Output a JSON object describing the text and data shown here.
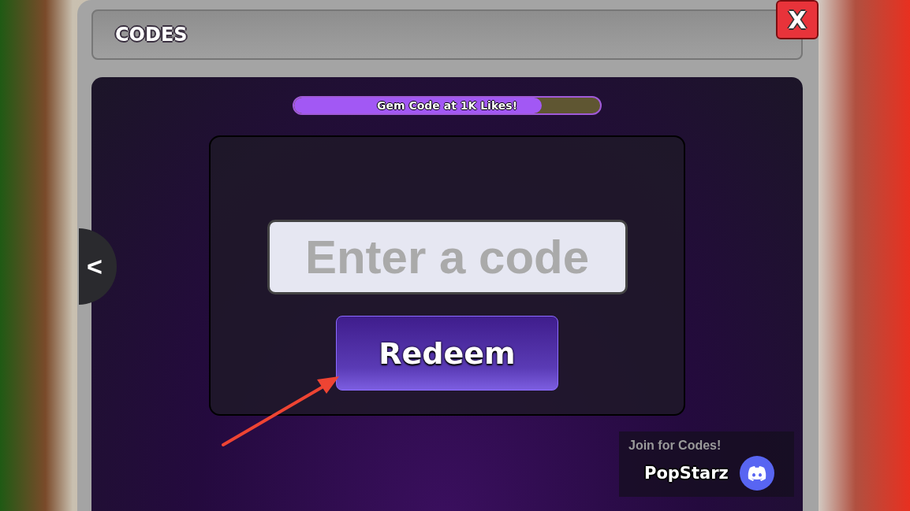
{
  "window": {
    "title": "CODES",
    "close_label": "X"
  },
  "side_tab": {
    "label": "<"
  },
  "progress": {
    "label": "Gem Code at 1K Likes!",
    "level": 0.81
  },
  "code_input": {
    "placeholder": "Enter a code"
  },
  "redeem_button": {
    "label": "Redeem"
  },
  "discord_promo": {
    "caption": "Join for Codes!",
    "name": "PopStarz"
  }
}
